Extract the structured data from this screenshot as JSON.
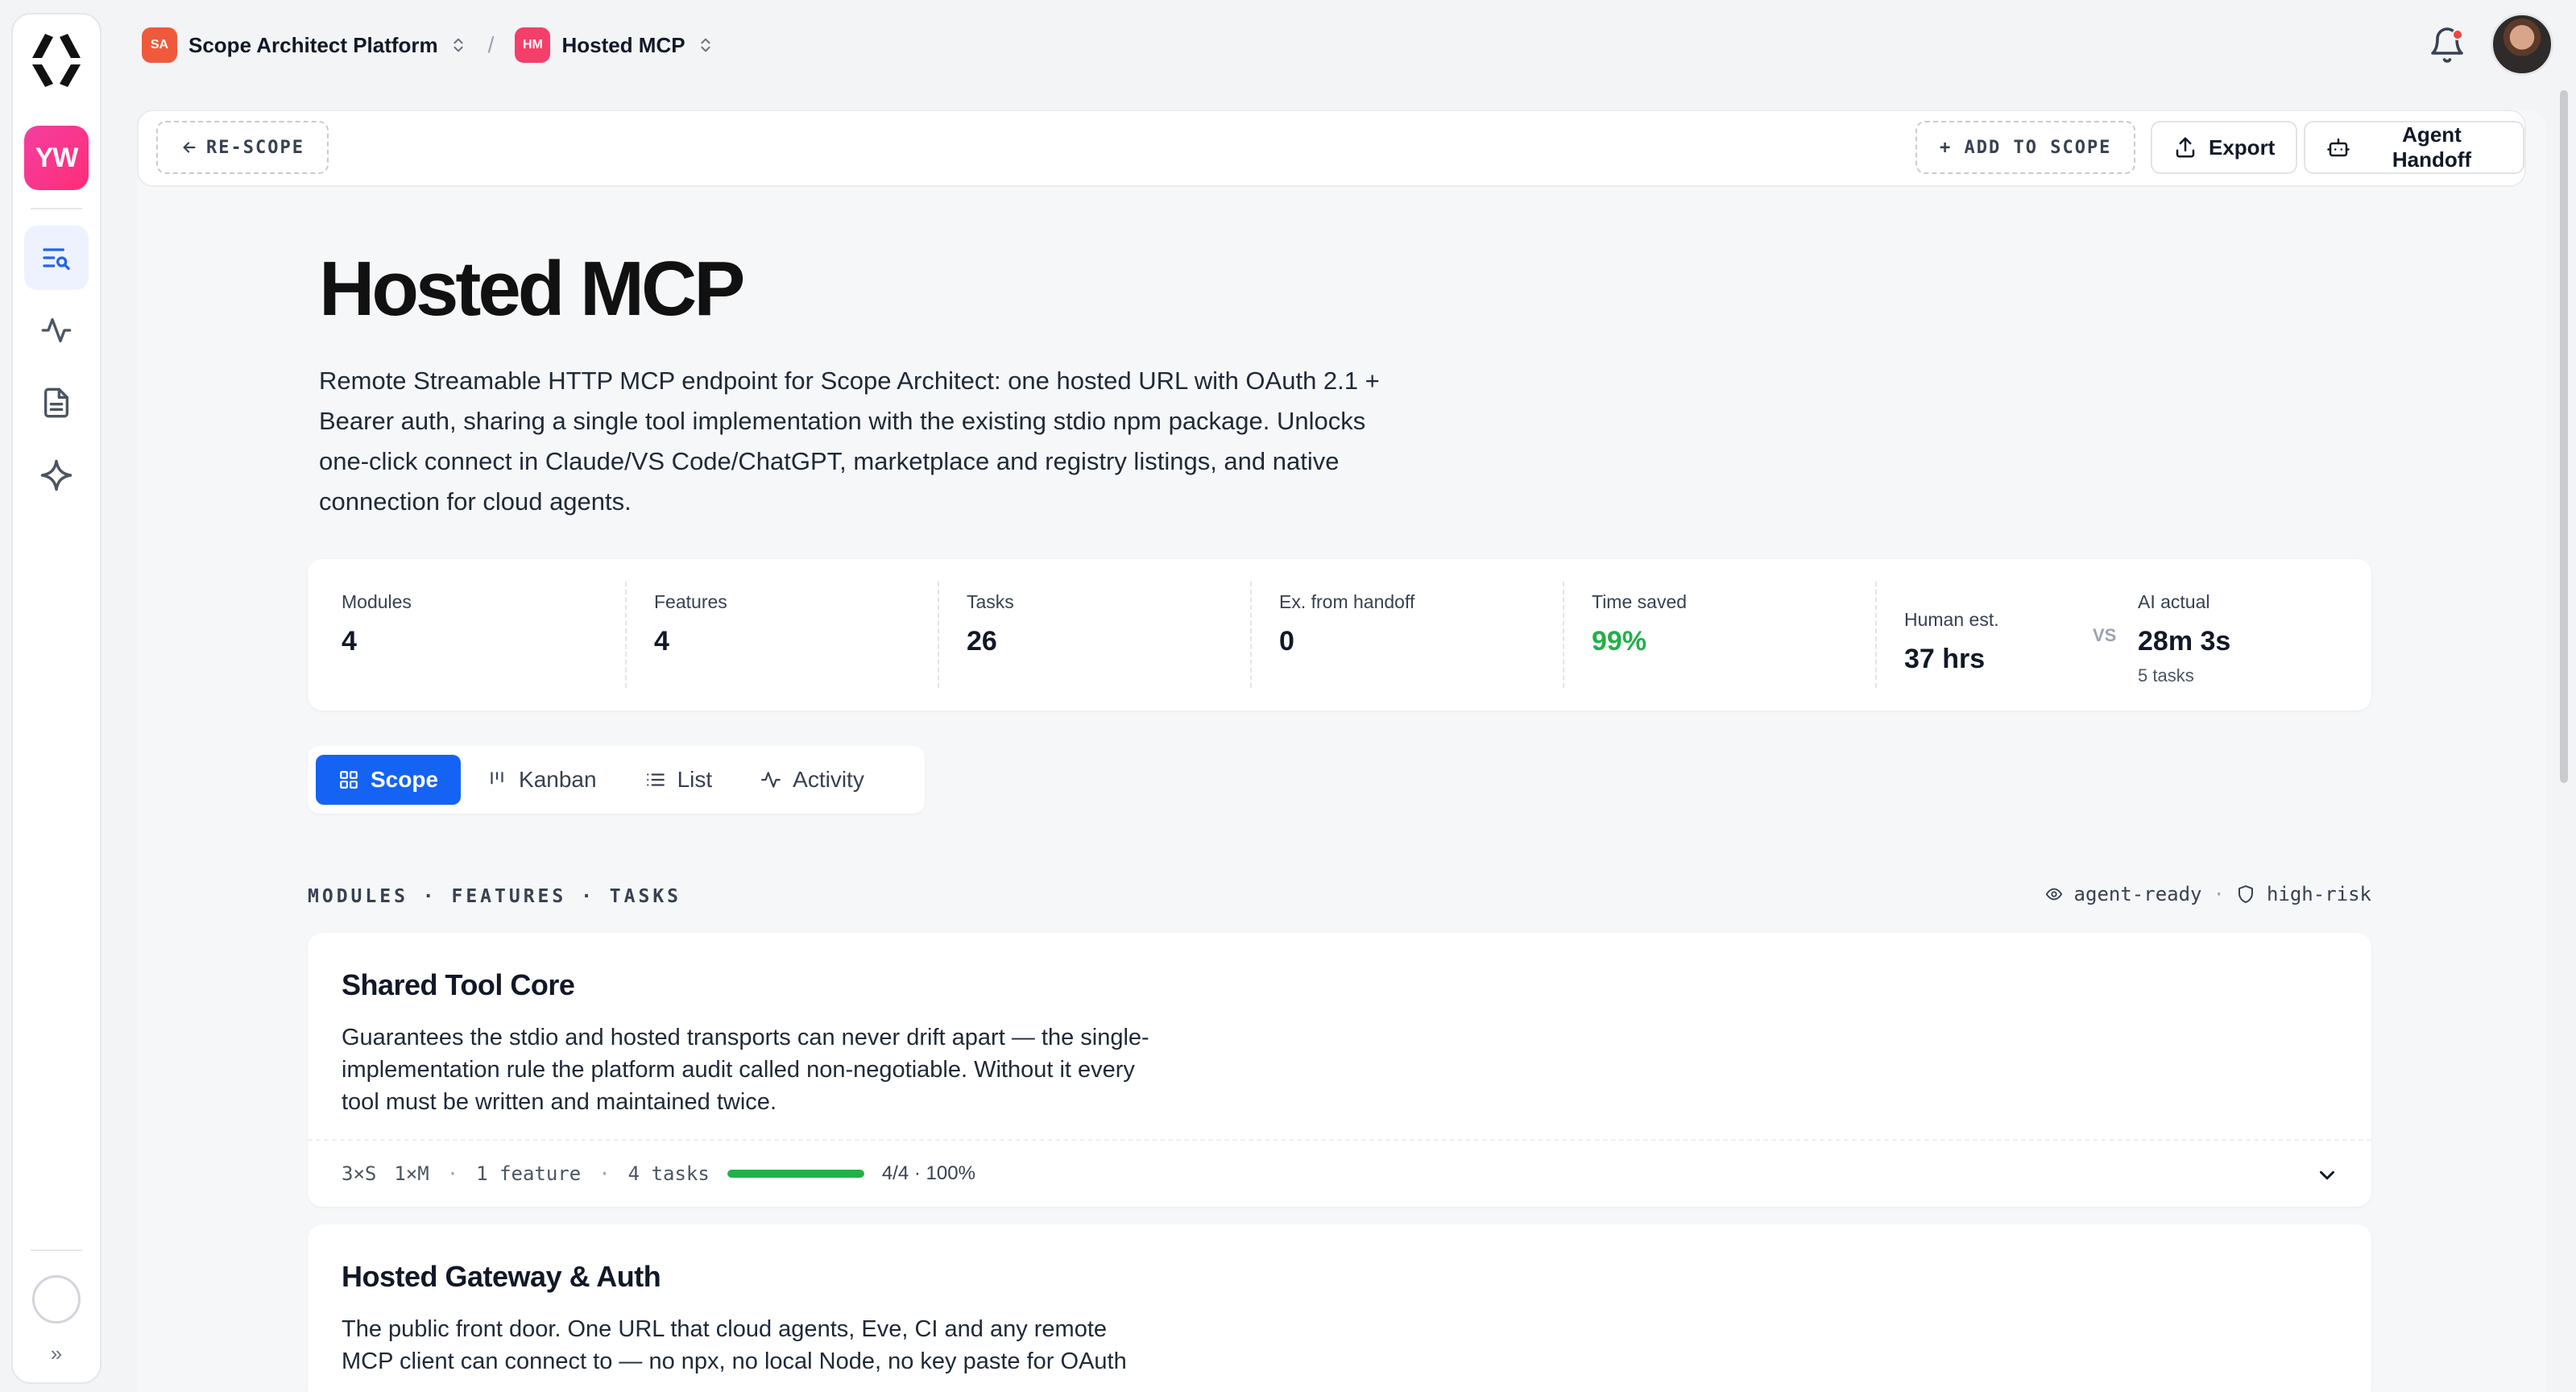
{
  "rail": {
    "workspace_initials": "YW"
  },
  "breadcrumb": {
    "org_badge": "SA",
    "org_name": "Scope Architect Platform",
    "project_badge": "HM",
    "project_name": "Hosted MCP"
  },
  "toolbar": {
    "rescope": "RE-SCOPE",
    "add_to_scope": "+ ADD TO SCOPE",
    "export": "Export",
    "agent_handoff": "Agent Handoff"
  },
  "page": {
    "title": "Hosted MCP",
    "description": "Remote Streamable HTTP MCP endpoint for Scope Architect: one hosted URL with OAuth 2.1 + Bearer auth, sharing a single tool implementation with the existing stdio npm package. Unlocks one-click connect in Claude/VS Code/ChatGPT, marketplace and registry listings, and native connection for cloud agents."
  },
  "stats": {
    "modules": {
      "label": "Modules",
      "value": "4"
    },
    "features": {
      "label": "Features",
      "value": "4"
    },
    "tasks": {
      "label": "Tasks",
      "value": "26"
    },
    "handoff": {
      "label": "Ex. from handoff",
      "value": "0"
    },
    "time_saved": {
      "label": "Time saved",
      "value": "99%"
    },
    "human": {
      "label": "Human est.",
      "value": "37 hrs"
    },
    "vs": "VS",
    "ai": {
      "label": "AI actual",
      "value": "28m 3s",
      "sub": "5 tasks"
    }
  },
  "tabs": {
    "scope": "Scope",
    "kanban": "Kanban",
    "list": "List",
    "activity": "Activity"
  },
  "section": {
    "label": "MODULES · FEATURES · TASKS",
    "legend_agent": "agent-ready",
    "legend_sep": "·",
    "legend_risk": "high-risk"
  },
  "modules": [
    {
      "title": "Shared Tool Core",
      "description": "Guarantees the stdio and hosted transports can never drift apart — the single-implementation rule the platform audit called non-negotiable. Without it every tool must be written and maintained twice.",
      "size_s": "3×S",
      "size_m": "1×M",
      "sep": "·",
      "features": "1 feature",
      "tasks": "4 tasks",
      "progress_pct": 100,
      "progress_text": "4/4 · 100%"
    },
    {
      "title": "Hosted Gateway & Auth",
      "description": "The public front door. One URL that cloud agents, Eve, CI and any remote MCP client can connect to — no npx, no local Node, no key paste for OAuth"
    }
  ],
  "colors": {
    "accent": "#1463f5",
    "success": "#22b04a",
    "workspace": "#ff2d78"
  }
}
